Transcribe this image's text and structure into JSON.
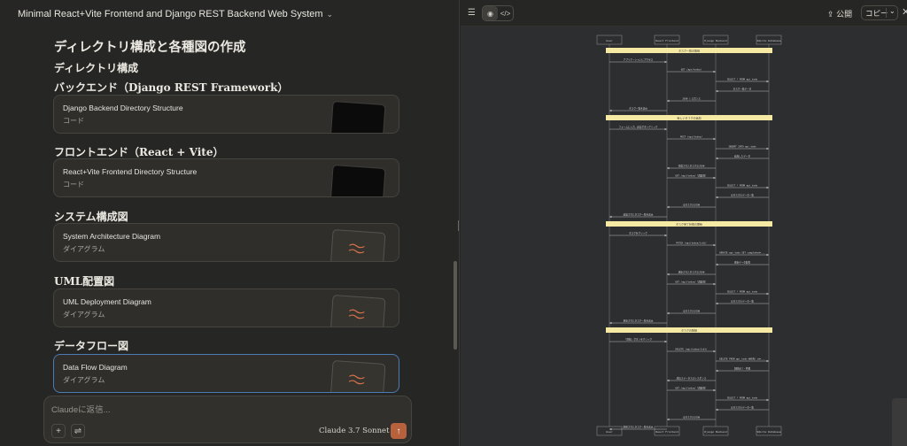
{
  "chat": {
    "title": "Minimal React+Vite Frontend and Django REST Backend Web System",
    "heading_main": "ディレクトリ構成と各種図の作成",
    "heading_dir": "ディレクトリ構成",
    "section_backend": "バックエンド（Django REST Framework）",
    "section_frontend": "フロントエンド（React + Vite）",
    "section_system": "システム構成図",
    "section_uml": "UML配置図",
    "section_dataflow": "データフロー図",
    "cards": [
      {
        "title": "Django Backend Directory Structure",
        "sub": "コード"
      },
      {
        "title": "React+Vite Frontend Directory Structure",
        "sub": "コード"
      },
      {
        "title": "System Architecture Diagram",
        "sub": "ダイアグラム"
      },
      {
        "title": "UML Deployment Diagram",
        "sub": "ダイアグラム"
      },
      {
        "title": "Data Flow Diagram",
        "sub": "ダイアグラム"
      }
    ]
  },
  "composer": {
    "placeholder": "Claudeに返信...",
    "model": "Claude 3.7 Sonnet",
    "icons": [
      "plus-icon",
      "sliders-icon",
      "chevron-down-icon",
      "arrow-up-icon"
    ]
  },
  "artifact": {
    "publish": "公開",
    "copy": "コピー",
    "icons": [
      "list-icon",
      "eye-icon",
      "code-icon",
      "share-icon",
      "close-icon"
    ]
  },
  "diagram": {
    "participants": [
      "User",
      "React Frontend",
      "Django Backend",
      "SQLite Database"
    ],
    "sections": [
      "タスク一覧の取得",
      "新しいタスクの追加",
      "タスク完了状態の更新",
      "タスクの削除"
    ],
    "messages": [
      "アプリケーションにアクセス",
      "GET /api/todos/",
      "SELECT * FROM api_todo",
      "タスク一覧データ",
      "JSON レスポンス",
      "タスク一覧を表示",
      "フォームに入力、送信ボタンクリック",
      "POST /api/todos/",
      "INSERT INTO api_todo",
      "追加したデータ",
      "作成されたタスクのJSON",
      "GET /api/todos/（再取得）",
      "SELECT * FROM api_todo",
      "全タスクのデータ一覧",
      "全タスクのJSON",
      "追加されたタスク一覧を表示",
      "タスクをクリック",
      "PATCH /api/todos/{id}/",
      "UPDATE api_todo SET completed=...",
      "更新データ取得",
      "更新されたタスクのJSON",
      "GET /api/todos/（再取得）",
      "SELECT * FROM api_todo",
      "全タスクのデータ一覧",
      "全タスクのJSON",
      "更新されたタスク一覧を表示",
      "「削除」ボタンをクリック",
      "DELETE /api/todos/{id}/",
      "DELETE FROM api_todo WHERE id=...",
      "削除完了・件数",
      "成功ステータスのレスポンス",
      "GET /api/todos/（再取得）",
      "SELECT * FROM api_todo",
      "全タスクのデータ一覧",
      "全タスクのJSON",
      "削除されたタスク一覧を表示"
    ]
  }
}
